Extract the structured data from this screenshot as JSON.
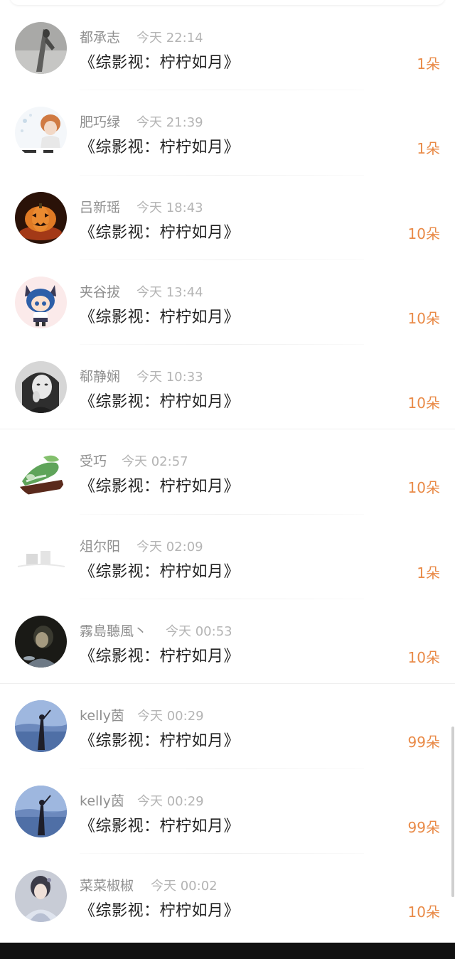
{
  "gift_list": [
    {
      "user": "都承志",
      "time": "今天 22:14",
      "gift": "《综影视：柠柠如月》",
      "amount": "1朵",
      "avatar": "gray-street-avatar"
    },
    {
      "user": "肥巧绿",
      "time": "今天 21:39",
      "gift": "《综影视：柠柠如月》",
      "amount": "1朵",
      "avatar": "girl-cartoon-avatar"
    },
    {
      "user": "吕新瑶",
      "time": "今天 18:43",
      "gift": "《综影视：柠柠如月》",
      "amount": "10朵",
      "avatar": "pumpkin-avatar"
    },
    {
      "user": "夹谷拔",
      "time": "今天 13:44",
      "gift": "《综影视：柠柠如月》",
      "amount": "10朵",
      "avatar": "anime-catgirl-avatar"
    },
    {
      "user": "郗静娴",
      "time": "今天 10:33",
      "gift": "《综影视：柠柠如月》",
      "amount": "10朵",
      "avatar": "bw-portrait-avatar"
    },
    {
      "user": "受巧",
      "time": "今天 02:57",
      "gift": "《综影视：柠柠如月》",
      "amount": "10朵",
      "avatar": "jade-cabbage-avatar"
    },
    {
      "user": "俎尔阳",
      "time": "今天 02:09",
      "gift": "《综影视：柠柠如月》",
      "amount": "1朵",
      "avatar": "faded-avatar"
    },
    {
      "user": "霧島聽風丶",
      "time": "今天 00:53",
      "gift": "《综影视：柠柠如月》",
      "amount": "10朵",
      "avatar": "dark-portrait-avatar"
    },
    {
      "user": "kelly茵",
      "time": "今天 00:29",
      "gift": "《综影视：柠柠如月》",
      "amount": "99朵",
      "avatar": "blue-sky-avatar"
    },
    {
      "user": "kelly茵",
      "time": "今天 00:29",
      "gift": "《综影视：柠柠如月》",
      "amount": "99朵",
      "avatar": "blue-sky-avatar"
    },
    {
      "user": "菜菜椒椒",
      "time": "今天 00:02",
      "gift": "《综影视：柠柠如月》",
      "amount": "10朵",
      "avatar": "hanfu-portrait-avatar"
    }
  ],
  "colors": {
    "amount": "#e98a47",
    "name": "#8f8f8f",
    "time": "#b4b4b4",
    "gift_text": "#222222"
  }
}
